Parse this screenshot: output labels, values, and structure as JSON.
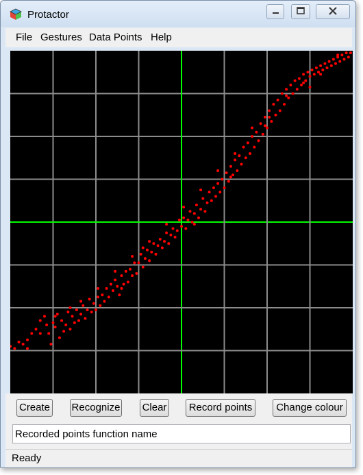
{
  "window": {
    "title": "Protactor"
  },
  "title_controls": {
    "minimize_icon": "minimize-icon",
    "maximize_icon": "maximize-icon",
    "close_icon": "close-icon"
  },
  "menu": [
    "File",
    "Gestures",
    "Data Points",
    "Help"
  ],
  "canvas": {
    "background": "#000000",
    "grid_color": "#8c8c8c",
    "axis_color": "#00ff00",
    "point_color": "#ff0000",
    "grid_divisions": 8
  },
  "buttons": {
    "create": "Create",
    "recognize": "Recognize",
    "clear": "Clear",
    "record": "Record points",
    "colour": "Change colour"
  },
  "input": {
    "value": "Recorded points function name"
  },
  "status": {
    "text": "Ready"
  },
  "chart_data": {
    "type": "scatter",
    "xlim": [
      -4,
      4
    ],
    "ylim": [
      -4,
      4
    ],
    "grid": true,
    "points": [
      [
        -4.0,
        -2.9
      ],
      [
        -3.9,
        -2.95
      ],
      [
        -3.8,
        -2.8
      ],
      [
        -3.7,
        -2.85
      ],
      [
        -3.6,
        -2.75
      ],
      [
        -3.5,
        -2.6
      ],
      [
        -3.4,
        -2.5
      ],
      [
        -3.3,
        -2.3
      ],
      [
        -3.2,
        -2.2
      ],
      [
        -3.15,
        -2.4
      ],
      [
        -3.1,
        -2.6
      ],
      [
        -3.05,
        -2.85
      ],
      [
        -3.0,
        -2.35
      ],
      [
        -2.95,
        -2.45
      ],
      [
        -2.9,
        -2.15
      ],
      [
        -2.85,
        -2.7
      ],
      [
        -2.8,
        -2.3
      ],
      [
        -2.75,
        -2.55
      ],
      [
        -2.7,
        -2.4
      ],
      [
        -2.65,
        -2.1
      ],
      [
        -2.6,
        -2.5
      ],
      [
        -2.55,
        -2.2
      ],
      [
        -2.5,
        -2.35
      ],
      [
        -2.45,
        -2.05
      ],
      [
        -2.4,
        -2.3
      ],
      [
        -2.35,
        -2.15
      ],
      [
        -2.3,
        -1.95
      ],
      [
        -2.25,
        -2.25
      ],
      [
        -2.2,
        -2.05
      ],
      [
        -2.15,
        -1.8
      ],
      [
        -2.1,
        -2.1
      ],
      [
        -2.05,
        -1.9
      ],
      [
        -2.0,
        -2.05
      ],
      [
        -1.95,
        -1.75
      ],
      [
        -1.9,
        -1.95
      ],
      [
        -1.85,
        -1.7
      ],
      [
        -1.8,
        -1.85
      ],
      [
        -1.75,
        -1.55
      ],
      [
        -1.7,
        -1.75
      ],
      [
        -1.65,
        -1.45
      ],
      [
        -1.6,
        -1.6
      ],
      [
        -1.55,
        -1.35
      ],
      [
        -1.5,
        -1.5
      ],
      [
        -1.45,
        -1.7
      ],
      [
        -1.4,
        -1.25
      ],
      [
        -1.35,
        -1.45
      ],
      [
        -1.3,
        -1.15
      ],
      [
        -1.25,
        -1.4
      ],
      [
        -1.2,
        -1.1
      ],
      [
        -1.15,
        -1.25
      ],
      [
        -1.1,
        -0.95
      ],
      [
        -1.05,
        -1.2
      ],
      [
        -1.0,
        -0.95
      ],
      [
        -0.95,
        -0.75
      ],
      [
        -0.9,
        -1.05
      ],
      [
        -0.85,
        -0.85
      ],
      [
        -0.8,
        -0.65
      ],
      [
        -0.75,
        -0.9
      ],
      [
        -0.7,
        -0.7
      ],
      [
        -0.65,
        -0.5
      ],
      [
        -0.6,
        -0.75
      ],
      [
        -0.55,
        -0.55
      ],
      [
        -0.5,
        -0.4
      ],
      [
        -0.45,
        -0.6
      ],
      [
        -0.4,
        -0.45
      ],
      [
        -0.35,
        -0.25
      ],
      [
        -0.3,
        -0.5
      ],
      [
        -0.25,
        -0.3
      ],
      [
        -0.2,
        -0.15
      ],
      [
        -0.15,
        -0.35
      ],
      [
        -0.1,
        -0.2
      ],
      [
        -0.05,
        0.05
      ],
      [
        0.0,
        -0.1
      ],
      [
        0.05,
        0.1
      ],
      [
        0.1,
        -0.15
      ],
      [
        0.15,
        0.05
      ],
      [
        0.2,
        0.25
      ],
      [
        0.25,
        0.0
      ],
      [
        0.3,
        0.2
      ],
      [
        0.35,
        0.4
      ],
      [
        0.4,
        0.1
      ],
      [
        0.45,
        0.3
      ],
      [
        0.5,
        0.55
      ],
      [
        0.55,
        0.25
      ],
      [
        0.6,
        0.45
      ],
      [
        0.65,
        0.7
      ],
      [
        0.7,
        0.5
      ],
      [
        0.75,
        0.8
      ],
      [
        0.8,
        0.6
      ],
      [
        0.85,
        0.9
      ],
      [
        0.9,
        0.7
      ],
      [
        0.95,
        1.0
      ],
      [
        1.0,
        0.8
      ],
      [
        1.05,
        1.15
      ],
      [
        1.1,
        0.95
      ],
      [
        1.15,
        1.3
      ],
      [
        1.2,
        1.1
      ],
      [
        1.25,
        1.45
      ],
      [
        1.3,
        1.2
      ],
      [
        1.35,
        1.55
      ],
      [
        1.4,
        1.35
      ],
      [
        1.45,
        1.75
      ],
      [
        1.5,
        1.5
      ],
      [
        1.55,
        1.85
      ],
      [
        1.6,
        1.6
      ],
      [
        1.65,
        2.0
      ],
      [
        1.7,
        1.75
      ],
      [
        1.75,
        2.1
      ],
      [
        1.8,
        1.9
      ],
      [
        1.85,
        2.3
      ],
      [
        1.9,
        2.05
      ],
      [
        1.95,
        2.45
      ],
      [
        2.0,
        2.2
      ],
      [
        2.05,
        2.6
      ],
      [
        2.1,
        2.35
      ],
      [
        2.15,
        2.75
      ],
      [
        2.2,
        2.5
      ],
      [
        2.25,
        2.85
      ],
      [
        2.3,
        2.6
      ],
      [
        2.35,
        3.0
      ],
      [
        2.4,
        2.75
      ],
      [
        2.45,
        3.1
      ],
      [
        2.5,
        2.9
      ],
      [
        2.55,
        3.2
      ],
      [
        2.6,
        3.0
      ],
      [
        2.65,
        3.3
      ],
      [
        2.7,
        3.1
      ],
      [
        2.75,
        3.35
      ],
      [
        2.8,
        3.2
      ],
      [
        2.85,
        3.45
      ],
      [
        2.9,
        3.3
      ],
      [
        2.95,
        3.5
      ],
      [
        3.0,
        3.4
      ],
      [
        3.05,
        3.55
      ],
      [
        3.1,
        3.45
      ],
      [
        3.15,
        3.6
      ],
      [
        3.2,
        3.5
      ],
      [
        3.25,
        3.65
      ],
      [
        3.3,
        3.55
      ],
      [
        3.35,
        3.7
      ],
      [
        3.4,
        3.6
      ],
      [
        3.45,
        3.75
      ],
      [
        3.5,
        3.65
      ],
      [
        3.55,
        3.8
      ],
      [
        3.6,
        3.7
      ],
      [
        3.65,
        3.85
      ],
      [
        3.7,
        3.75
      ],
      [
        3.75,
        3.9
      ],
      [
        3.8,
        3.8
      ],
      [
        3.85,
        3.95
      ],
      [
        3.9,
        3.85
      ],
      [
        3.95,
        3.95
      ],
      [
        -3.3,
        -2.6
      ],
      [
        -2.95,
        -2.2
      ],
      [
        -2.35,
        -1.85
      ],
      [
        -1.95,
        -1.55
      ],
      [
        -1.55,
        -1.15
      ],
      [
        -1.15,
        -0.8
      ],
      [
        -0.75,
        -0.45
      ],
      [
        -0.35,
        -0.05
      ],
      [
        0.05,
        0.35
      ],
      [
        0.45,
        0.75
      ],
      [
        0.85,
        1.2
      ],
      [
        1.25,
        1.6
      ],
      [
        1.65,
        2.2
      ],
      [
        2.05,
        2.45
      ],
      [
        2.45,
        2.95
      ],
      [
        2.85,
        3.25
      ],
      [
        3.25,
        3.45
      ],
      [
        3.65,
        3.9
      ],
      [
        -3.6,
        -2.95
      ],
      [
        -2.6,
        -2.0
      ],
      [
        -1.4,
        -1.55
      ],
      [
        -0.9,
        -0.6
      ],
      [
        0.3,
        -0.05
      ],
      [
        1.15,
        1.05
      ],
      [
        1.95,
        2.25
      ],
      [
        3.0,
        3.15
      ]
    ]
  }
}
